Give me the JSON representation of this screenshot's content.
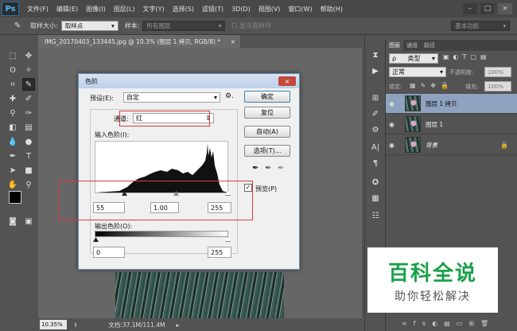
{
  "app": {
    "logo": "Ps"
  },
  "menu": [
    "文件(F)",
    "编辑(E)",
    "图像(I)",
    "图层(L)",
    "文字(Y)",
    "选择(S)",
    "滤镜(T)",
    "3D(D)",
    "视图(V)",
    "窗口(W)",
    "帮助(H)"
  ],
  "window_controls": [
    "–",
    "□",
    "×"
  ],
  "options_bar": {
    "sample_size_label": "取样大小:",
    "sample_size_value": "取样点",
    "sample_label": "样本:",
    "sample_value": "所有图层",
    "show_ring_label": "显示取样环",
    "workspace": "基本功能"
  },
  "document": {
    "tab_title": "IMG_20170403_133445.jpg @ 10.3% (图层 1 拷贝, RGB/8) *",
    "tab_close": "×"
  },
  "status": {
    "zoom": "10.35%",
    "doc_info": "文档:37.1M/111.4M"
  },
  "layers_panel": {
    "tabs": [
      "图层",
      "通道",
      "路径"
    ],
    "kind_filter": "类型",
    "blend_mode": "正常",
    "opacity_label": "不透明度:",
    "opacity_value": "100%",
    "lock_label": "锁定:",
    "fill_label": "填充:",
    "fill_value": "100%",
    "layers": [
      {
        "name": "图层 1 拷贝",
        "selected": true
      },
      {
        "name": "图层 1",
        "selected": false
      },
      {
        "name": "背景",
        "selected": false,
        "locked": true
      }
    ]
  },
  "levels_dialog": {
    "title": "色阶",
    "close": "×",
    "preset_label": "预设(E):",
    "preset_value": "自定",
    "channel_label": "通道:",
    "channel_value": "红",
    "input_levels_label": "输入色阶(I):",
    "input_black": "55",
    "input_gamma": "1.00",
    "input_white": "255",
    "output_levels_label": "输出色阶(O):",
    "output_black": "0",
    "output_white": "255",
    "buttons": {
      "ok": "确定",
      "reset": "复位",
      "auto": "自动(A)",
      "options": "选项(T)..."
    },
    "preview_label": "预览(P)",
    "preview_checked": true
  },
  "watermark": {
    "title": "百科全说",
    "subtitle": "助你轻松解决"
  },
  "colors": {
    "accent_red": "#e03a3a",
    "selected_layer": "#8ea2c0",
    "watermark_green": "#1aa04a"
  }
}
